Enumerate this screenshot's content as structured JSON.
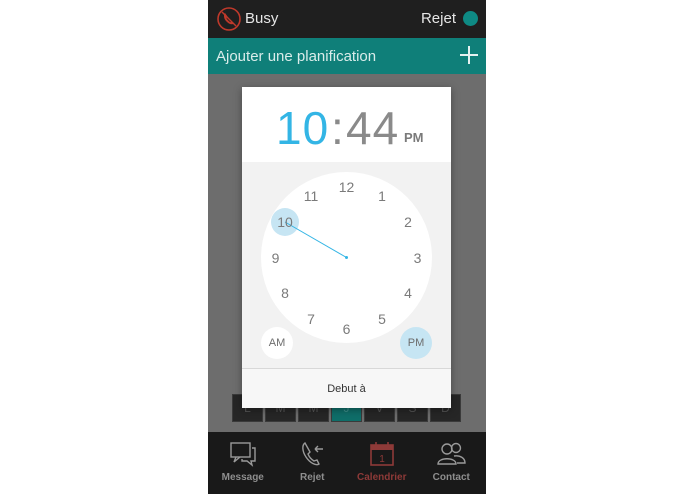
{
  "statusbar": {
    "status": "Busy",
    "reject_label": "Rejet",
    "dot_color": "#0e8a84"
  },
  "header": {
    "title": "Ajouter une planification",
    "add_icon": "plus-icon"
  },
  "days": [
    {
      "label": "L",
      "active": false
    },
    {
      "label": "M",
      "active": false
    },
    {
      "label": "M",
      "active": false
    },
    {
      "label": "J",
      "active": true
    },
    {
      "label": "V",
      "active": false
    },
    {
      "label": "S",
      "active": false
    },
    {
      "label": "D",
      "active": false
    }
  ],
  "dialog": {
    "hour": "10",
    "separator": ":",
    "minute": "44",
    "ampm": "PM",
    "accent_color": "#33b5e5",
    "clock_numbers": [
      "12",
      "1",
      "2",
      "3",
      "4",
      "5",
      "6",
      "7",
      "8",
      "9",
      "10",
      "11"
    ],
    "selected_hour": 10,
    "am_label": "AM",
    "pm_label": "PM",
    "selected_period": "PM",
    "confirm_label": "Debut à"
  },
  "nav": [
    {
      "label": "Message",
      "icon": "message-icon",
      "active": false
    },
    {
      "label": "Rejet",
      "icon": "phone-reject-icon",
      "active": false
    },
    {
      "label": "Calendrier",
      "icon": "calendar-icon",
      "active": true
    },
    {
      "label": "Contact",
      "icon": "contacts-icon",
      "active": false
    }
  ]
}
